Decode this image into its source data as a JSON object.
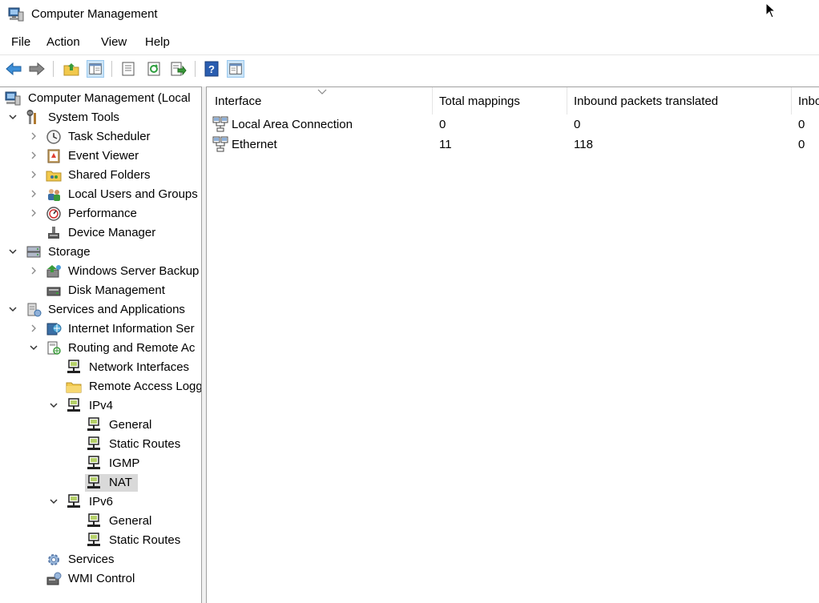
{
  "window": {
    "title": "Computer Management"
  },
  "menu": {
    "items": [
      "File",
      "Action",
      "View",
      "Help"
    ]
  },
  "toolbar": {
    "buttons": [
      "back-icon",
      "forward-icon",
      "up-folder-icon",
      "show-hide-tree-icon",
      "properties-icon",
      "refresh-icon",
      "export-list-icon",
      "help-icon",
      "show-hide-action-pane-icon"
    ]
  },
  "tree": {
    "root": "Computer Management (Local",
    "system_tools": "System Tools",
    "task_scheduler": "Task Scheduler",
    "event_viewer": "Event Viewer",
    "shared_folders": "Shared Folders",
    "local_users": "Local Users and Groups",
    "performance": "Performance",
    "device_manager": "Device Manager",
    "storage": "Storage",
    "ws_backup": "Windows Server Backup",
    "disk_management": "Disk Management",
    "services_apps": "Services and Applications",
    "iis": "Internet Information Ser",
    "routing": "Routing and Remote Ac",
    "network_interfaces": "Network Interfaces",
    "remote_access_log": "Remote Access Logg",
    "ipv4": "IPv4",
    "ipv4_general": "General",
    "ipv4_static_routes": "Static Routes",
    "igmp": "IGMP",
    "nat": "NAT",
    "ipv6": "IPv6",
    "ipv6_general": "General",
    "ipv6_static_routes": "Static Routes",
    "services": "Services",
    "wmi_control": "WMI Control"
  },
  "list": {
    "columns": [
      "Interface",
      "Total mappings",
      "Inbound packets translated",
      "Inbo"
    ],
    "rows": [
      {
        "interface": "Local Area Connection",
        "total_mappings": "0",
        "inbound_packets": "0",
        "inbo": "0"
      },
      {
        "interface": "Ethernet",
        "total_mappings": "11",
        "inbound_packets": "118",
        "inbo": "0"
      }
    ]
  }
}
